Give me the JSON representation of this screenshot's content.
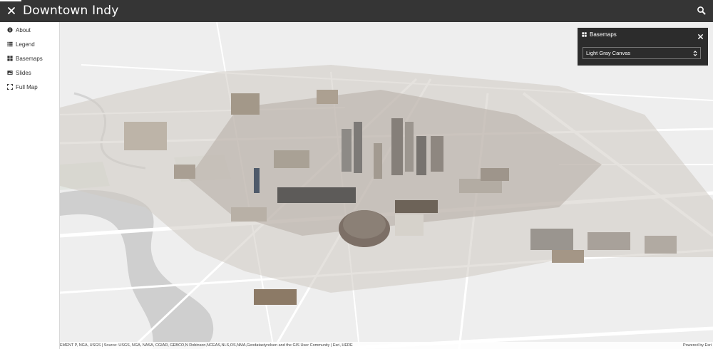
{
  "header": {
    "title": "Downtown Indy"
  },
  "sidebar": {
    "items": [
      {
        "label": "About",
        "icon": "info-icon"
      },
      {
        "label": "Legend",
        "icon": "list-icon"
      },
      {
        "label": "Basemaps",
        "icon": "grid-icon"
      },
      {
        "label": "Slides",
        "icon": "image-icon"
      },
      {
        "label": "Full Map",
        "icon": "expand-icon"
      }
    ]
  },
  "basemaps_panel": {
    "title": "Basemaps",
    "selected": "Light Gray Canvas"
  },
  "attribution": {
    "credits": "EMENT P, NGA, USGS | Source: USGS, NGA, NASA, CGIAR, GEBCO,N Robinson,NCEAS,NLS,OS,NMA,Geodatastyrelsen and the GIS User Community | Esri, HERE",
    "powered": "Powered by Esri"
  },
  "colors": {
    "topbar": "#353535",
    "panel": "#2c2c2c",
    "map_base": "#ececec"
  }
}
